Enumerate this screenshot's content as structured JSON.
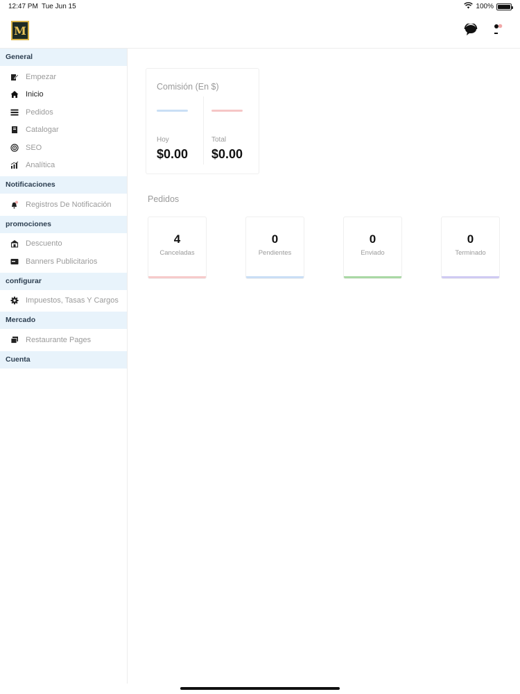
{
  "status": {
    "time": "12:47 PM",
    "date": "Tue Jun 15",
    "battery": "100%",
    "battery_level": 1.0
  },
  "header": {
    "logo_letter": "M"
  },
  "sidebar": {
    "sections": [
      {
        "title": "General",
        "items": [
          {
            "label": "Empezar",
            "icon": "edit-icon"
          },
          {
            "label": "Inicio",
            "icon": "home-icon",
            "active": true
          },
          {
            "label": "Pedidos",
            "icon": "list-icon"
          },
          {
            "label": "Catalogar",
            "icon": "book-icon"
          },
          {
            "label": "SEO",
            "icon": "target-icon"
          },
          {
            "label": "Analítica",
            "icon": "chart-icon"
          }
        ]
      },
      {
        "title": "Notificaciones",
        "items": [
          {
            "label": "Registros De Notificación",
            "icon": "bell-icon"
          }
        ]
      },
      {
        "title": "promociones",
        "items": [
          {
            "label": "Descuento",
            "icon": "store-icon"
          },
          {
            "label": "Banners Publicitarios",
            "icon": "banner-icon"
          }
        ]
      },
      {
        "title": "configurar",
        "items": [
          {
            "label": "Impuestos, Tasas Y Cargos",
            "icon": "gear-icon"
          }
        ]
      },
      {
        "title": "Mercado",
        "items": [
          {
            "label": "Restaurante Pages",
            "icon": "pages-icon"
          }
        ]
      },
      {
        "title": "Cuenta",
        "items": []
      }
    ]
  },
  "commission": {
    "title": "Comisión (En $)",
    "today_label": "Hoy",
    "today_value": "$0.00",
    "total_label": "Total",
    "total_value": "$0.00"
  },
  "orders": {
    "title": "Pedidos",
    "cards": [
      {
        "value": "4",
        "label": "Canceladas",
        "color": "#f6caca"
      },
      {
        "value": "0",
        "label": "Pendientes",
        "color": "#c9def5"
      },
      {
        "value": "0",
        "label": "Enviado",
        "color": "#a9d8a4"
      },
      {
        "value": "0",
        "label": "Terminado",
        "color": "#cfcaf2"
      }
    ]
  }
}
